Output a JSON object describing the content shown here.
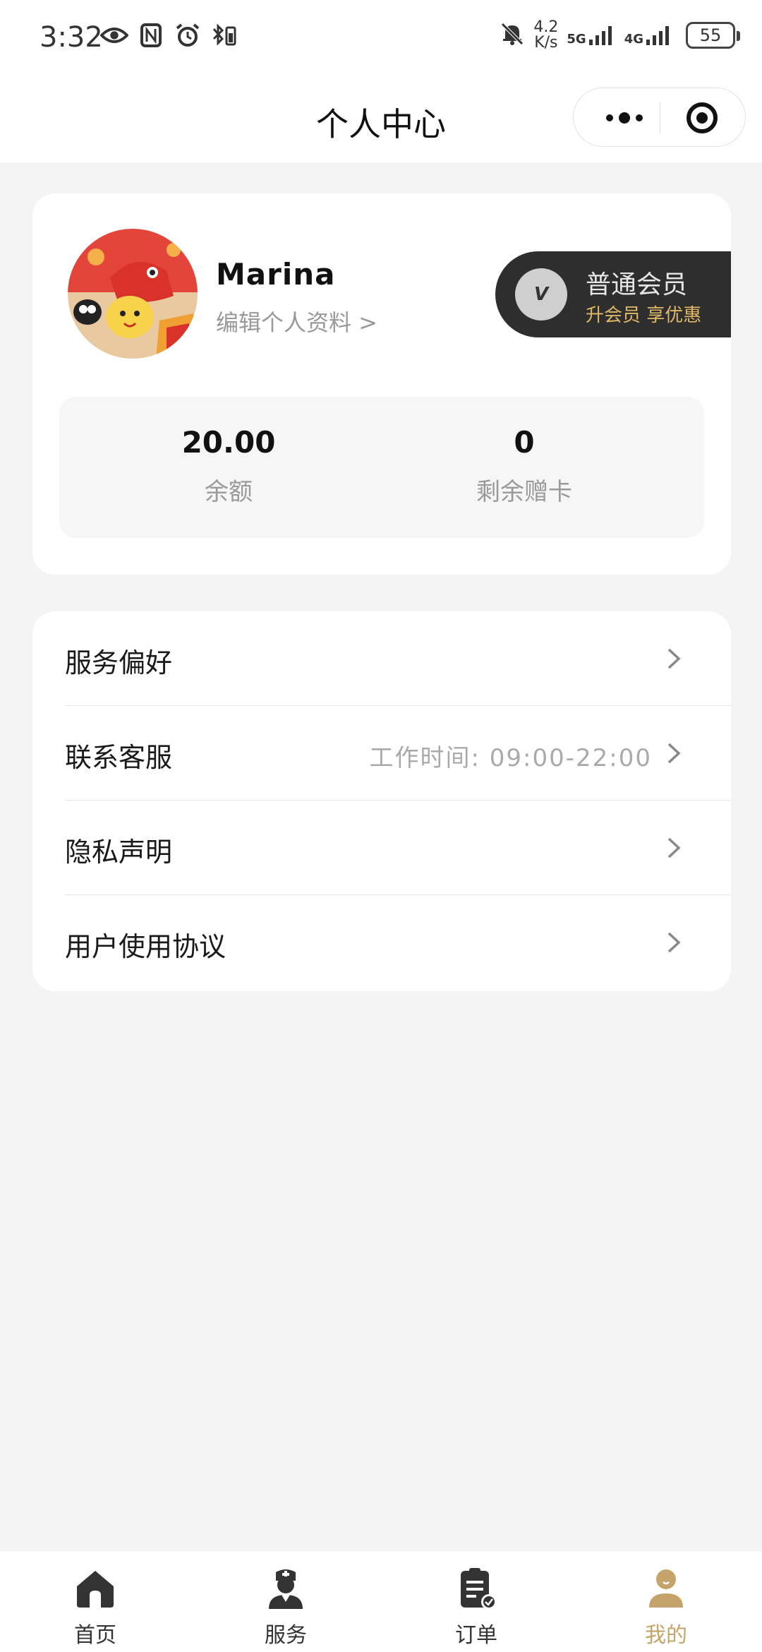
{
  "status_bar": {
    "time": "3:32",
    "net_speed_value": "4.2",
    "net_speed_unit": "K/s",
    "signal_1": "5G",
    "signal_2": "4G",
    "battery": "55"
  },
  "header": {
    "title": "个人中心"
  },
  "profile": {
    "name": "Marina",
    "edit_link": "编辑个人资料 >",
    "vip": {
      "logo_text": "V",
      "title": "普通会员",
      "subtitle": "升会员 享优惠"
    },
    "stats": [
      {
        "value": "20.00",
        "label": "余额"
      },
      {
        "value": "0",
        "label": "剩余赠卡"
      }
    ]
  },
  "menu": {
    "items": [
      {
        "label": "服务偏好",
        "extra": ""
      },
      {
        "label": "联系客服",
        "extra": "工作时间: 09:00-22:00"
      },
      {
        "label": "隐私声明",
        "extra": ""
      },
      {
        "label": "用户使用协议",
        "extra": ""
      }
    ]
  },
  "tabbar": {
    "items": [
      {
        "label": "首页",
        "icon": "home-icon"
      },
      {
        "label": "服务",
        "icon": "nurse-icon"
      },
      {
        "label": "订单",
        "icon": "clipboard-icon"
      },
      {
        "label": "我的",
        "icon": "user-icon"
      }
    ],
    "active_index": 3
  },
  "colors": {
    "accent": "#c4a46a",
    "vip_bg": "#2e2e2e",
    "vip_sub": "#e0b866",
    "page_bg": "#f4f4f4"
  }
}
